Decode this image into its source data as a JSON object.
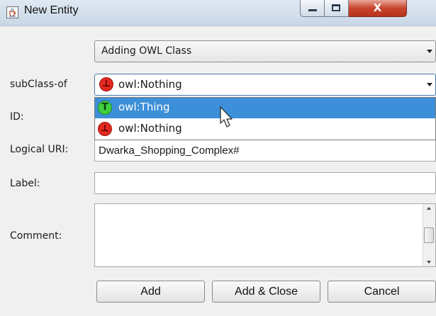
{
  "window": {
    "title": "New Entity",
    "icon": "java-cup-icon"
  },
  "title_buttons": {
    "minimize": "minimize-icon",
    "maximize": "maximize-icon",
    "close_label": "X"
  },
  "form": {
    "entity_type": "Adding OWL Class",
    "subclass_label": "subClass-of",
    "subclass_value": "owl:Nothing",
    "subclass_badge": "⊥",
    "id_label": "ID:",
    "logical_uri_label": "Logical URI:",
    "logical_uri_value": "Dwarka_Shopping_Complex#",
    "label_label": "Label:",
    "label_value": "",
    "comment_label": "Comment:",
    "comment_value": ""
  },
  "dropdown": {
    "options": [
      {
        "badge": "T",
        "label": "owl:Thing",
        "selected": true
      },
      {
        "badge": "⊥",
        "label": "owl:Nothing",
        "selected": false
      }
    ]
  },
  "buttons": {
    "add": "Add",
    "add_close": "Add & Close",
    "cancel": "Cancel"
  },
  "colors": {
    "selection": "#3c8fd8",
    "thing_badge": "#3fcf3f",
    "nothing_badge": "#e3281e",
    "close_button": "#c8452e"
  }
}
